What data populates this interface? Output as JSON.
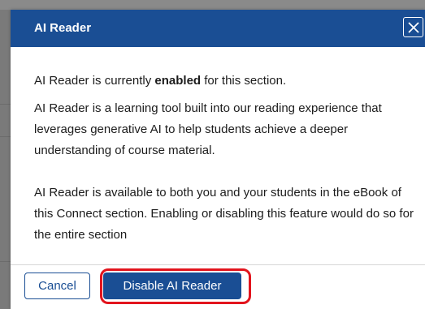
{
  "dialog": {
    "title": "AI Reader",
    "close_icon": "close-icon",
    "status_prefix": "AI Reader is currently ",
    "status_value": "enabled",
    "status_suffix": " for this section.",
    "description": "AI Reader is a learning tool built into our reading experience that leverages generative AI to help students achieve a deeper understanding of course material.",
    "availability": "AI Reader is available to both you and your students in the eBook of this Connect section. Enabling or disabling this feature would do so for the entire section"
  },
  "footer": {
    "cancel_label": "Cancel",
    "disable_label": "Disable AI Reader"
  },
  "colors": {
    "header": "#1a4e94",
    "primary_button": "#1a4e94",
    "highlight": "#e2141d"
  }
}
